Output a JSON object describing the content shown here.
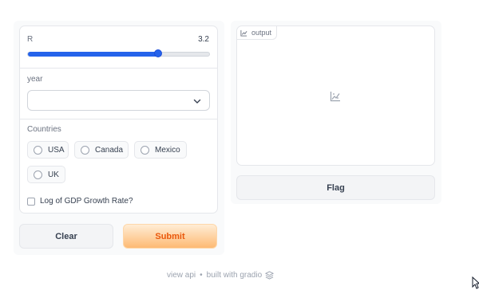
{
  "slider": {
    "label": "R",
    "value": "3.2",
    "fraction": 0.72
  },
  "year": {
    "label": "year",
    "value": ""
  },
  "countries": {
    "label": "Countries",
    "options": [
      "USA",
      "Canada",
      "Mexico",
      "UK"
    ]
  },
  "log_checkbox": {
    "label": "Log of GDP Growth Rate?",
    "checked": false
  },
  "buttons": {
    "clear": "Clear",
    "submit": "Submit",
    "flag": "Flag"
  },
  "output": {
    "label": "output"
  },
  "footer": {
    "api": "view api",
    "built": "built with gradio"
  },
  "colors": {
    "accent": "#2563eb",
    "submit_text": "#ea580c",
    "submit_bg": "#fdba74"
  },
  "icons": [
    "chart-icon",
    "chevron-down-icon",
    "gradio-logo-icon",
    "cursor-icon"
  ]
}
